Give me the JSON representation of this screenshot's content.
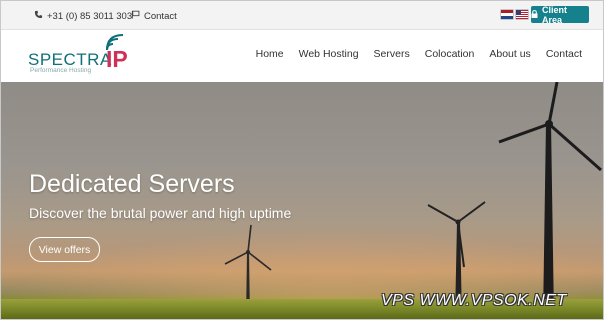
{
  "topbar": {
    "phone": "+31 (0) 85 3011 303",
    "contact_label": "Contact",
    "client_area_label": "Client Area",
    "phone_icon": "phone-icon",
    "contact_icon": "flag-icon",
    "lock_icon": "lock-icon"
  },
  "logo": {
    "name_part1": "SPECTRA",
    "name_part2": "IP",
    "tagline": "Performance Hosting"
  },
  "nav": {
    "items": [
      "Home",
      "Web Hosting",
      "Servers",
      "Colocation",
      "About us",
      "Contact"
    ]
  },
  "hero": {
    "title": "Dedicated Servers",
    "subtitle": "Discover the brutal power and high uptime",
    "button_label": "View offers"
  },
  "watermark": {
    "text": "VPS WWW.VPSOK.NET"
  },
  "colors": {
    "accent": "#14818c",
    "logo_teal": "#0f6f7b",
    "logo_red": "#d03058"
  }
}
